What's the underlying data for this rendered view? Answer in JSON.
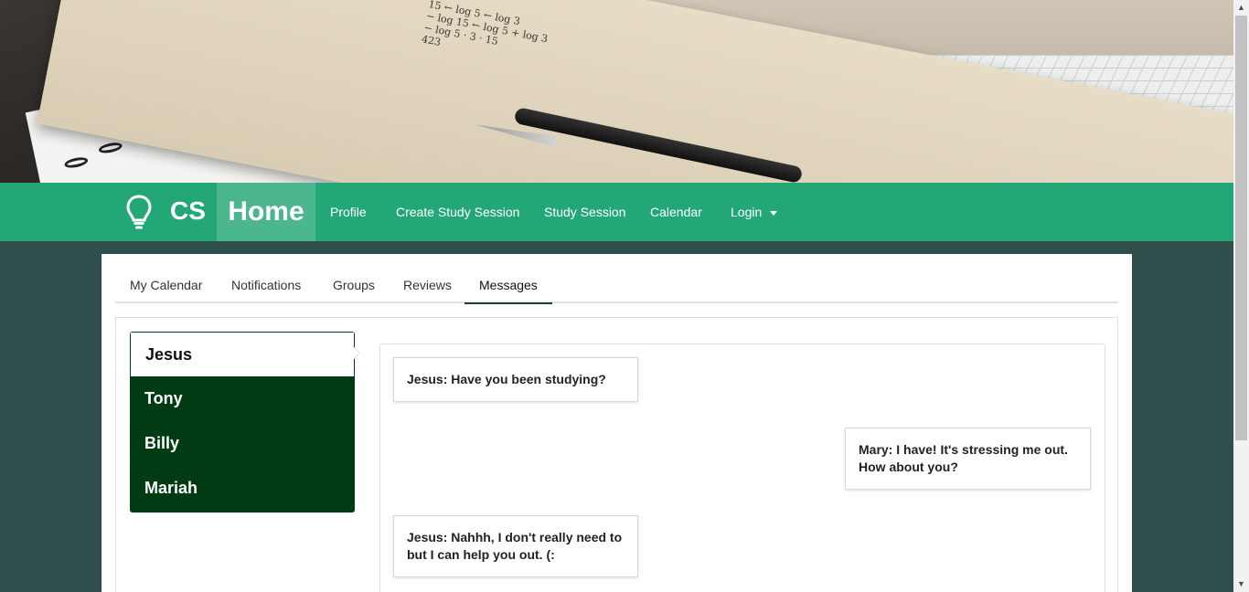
{
  "hero": {
    "math_lines": [
      "15 ← log 5 ← log 3",
      "− log 15 ← log 5 + log 3",
      "− log 5 · 3 · 15",
      "423"
    ]
  },
  "navbar": {
    "brand": "CS",
    "home": "Home",
    "links": [
      "Profile",
      "Create Study Session",
      "Study Session",
      "Calendar",
      "Login"
    ],
    "accent_color": "#24a776"
  },
  "tabs": [
    "My Calendar",
    "Notifications",
    "Groups",
    "Reviews",
    "Messages"
  ],
  "active_tab": "Messages",
  "contacts": [
    "Jesus",
    "Tony",
    "Billy",
    "Mariah"
  ],
  "active_contact": "Jesus",
  "messages": [
    {
      "from": "Jesus",
      "text": "Jesus: Have you been studying?"
    },
    {
      "from": "Mary",
      "text": "Mary: I have! It's stressing me out. How about you?"
    },
    {
      "from": "Jesus",
      "text": "Jesus: Nahhh, I don't really need to but I can help you out. (:"
    }
  ],
  "colors": {
    "page_bg": "#2e4f4c",
    "contacts_bg": "#003b13",
    "home_bg": "#4cb78e"
  }
}
